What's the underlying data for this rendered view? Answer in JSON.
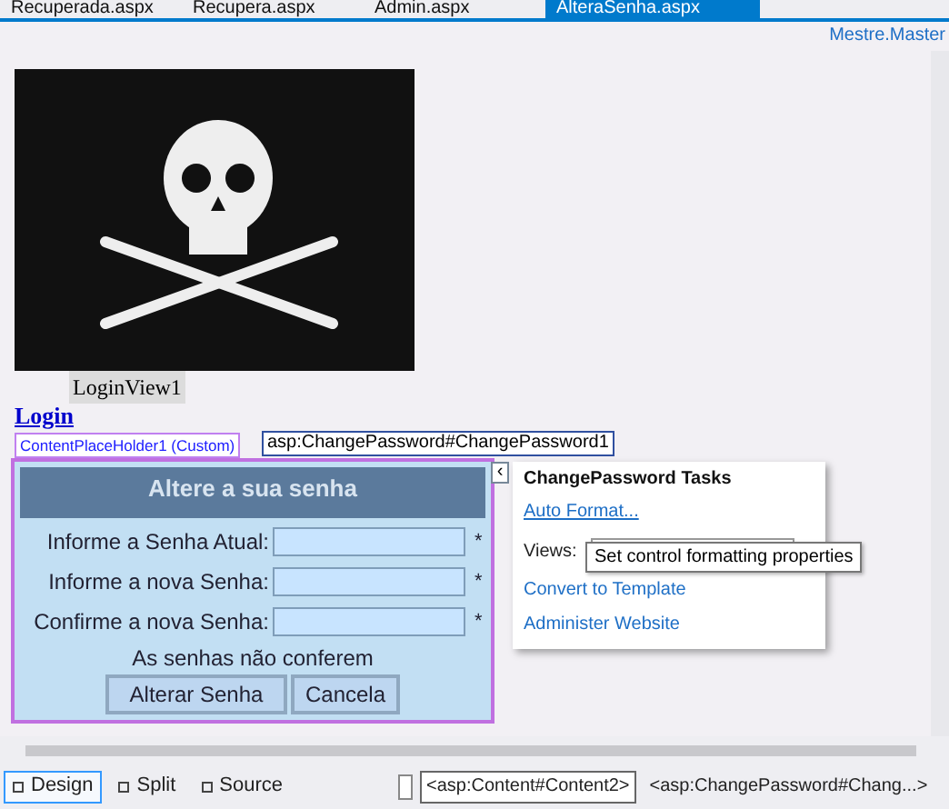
{
  "tabs": [
    {
      "label": "Recuperada.aspx",
      "selected": false
    },
    {
      "label": "Recupera.aspx",
      "selected": false
    },
    {
      "label": "Admin.aspx",
      "selected": false
    },
    {
      "label": "AlteraSenha.aspx",
      "selected": true
    }
  ],
  "master_link": "Mestre.Master",
  "canvas": {
    "image_label": "LoginView1",
    "login_link": "Login",
    "placeholder_tag": "ContentPlaceHolder1 (Custom)",
    "control_tag": "asp:ChangePassword#ChangePassword1"
  },
  "change_password": {
    "title": "Altere a sua senha",
    "fields": [
      {
        "label": "Informe a Senha Atual:",
        "required_mark": "*"
      },
      {
        "label": "Informe a nova Senha:",
        "required_mark": "*"
      },
      {
        "label": "Confirme a nova Senha:",
        "required_mark": "*"
      }
    ],
    "error": "As senhas não conferem",
    "buttons": [
      "Alterar Senha",
      "Cancela"
    ]
  },
  "tasks_panel": {
    "title": "ChangePassword Tasks",
    "items": [
      {
        "kind": "link",
        "label": "Auto Format...",
        "hovered": true
      },
      {
        "kind": "dropdown",
        "label": "Views:"
      },
      {
        "kind": "link",
        "label": "Convert to Template",
        "hovered": false
      },
      {
        "kind": "link",
        "label": "Administer Website",
        "hovered": false
      }
    ]
  },
  "tooltip": "Set control formatting properties",
  "smart_tag_glyph": "‹",
  "view_buttons": [
    {
      "label": "Design",
      "selected": true
    },
    {
      "label": "Split",
      "selected": false
    },
    {
      "label": "Source",
      "selected": false
    }
  ],
  "breadcrumb": [
    "<asp:Content#Content2>",
    "<asp:ChangePassword#Chang...>"
  ]
}
